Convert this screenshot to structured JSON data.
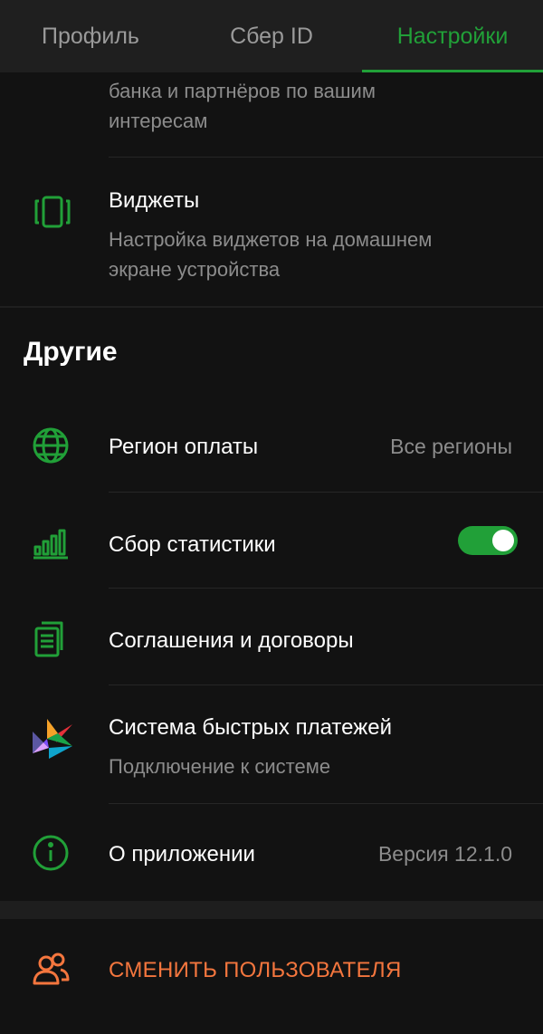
{
  "tabs": [
    {
      "label": "Профиль",
      "active": false
    },
    {
      "label": "Сбер ID",
      "active": false
    },
    {
      "label": "Настройки",
      "active": true
    }
  ],
  "partial_item": {
    "subtitle_line1": "банка и партнёров по вашим",
    "subtitle_line2": "интересам"
  },
  "widgets": {
    "title": "Виджеты",
    "subtitle_line1": "Настройка виджетов на домашнем",
    "subtitle_line2": "экране устройства",
    "icon": "widgets-icon"
  },
  "others": {
    "section_title": "Другие",
    "items": [
      {
        "title": "Регион оплаты",
        "value": "Все регионы",
        "icon": "globe-icon"
      },
      {
        "title": "Сбор статистики",
        "toggle_on": true,
        "icon": "statistics-icon"
      },
      {
        "title": "Соглашения и договоры",
        "icon": "documents-icon"
      },
      {
        "title": "Система быстрых платежей",
        "subtitle": "Подключение к системе",
        "icon": "sbp-logo-icon"
      },
      {
        "title": "О приложении",
        "value": "Версия 12.1.0",
        "icon": "info-icon"
      }
    ]
  },
  "logout": {
    "label": "СМЕНИТЬ ПОЛЬЗОВАТЕЛЯ",
    "icon": "users-icon"
  },
  "colors": {
    "accent": "#21a038",
    "danger": "#f4763e",
    "background": "#121212"
  }
}
